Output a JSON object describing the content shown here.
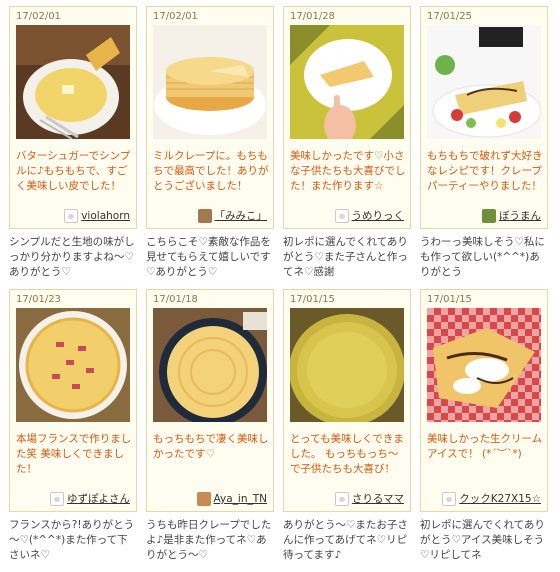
{
  "cards": [
    {
      "date": "17/02/01",
      "message": "バターシュガーでシンプルに♪もちもちで、すごく美味しい皮でした！",
      "author": "violahorn",
      "avatar": "generic-avatar-icon",
      "reply": "シンプルだと生地の味がしっかり分かりますよね～♡ありがとう♡"
    },
    {
      "date": "17/02/01",
      "message": "ミルクレープに。もちもちで最高でした！ありがとうございました！",
      "author": "「みみこ」",
      "avatar": "photo-avatar-icon",
      "reply": "こちらこそ♡素敵な作品を見せてもらえて嬉しいです♡ありがとう♡"
    },
    {
      "date": "17/01/28",
      "message": "美味しかったです♡小さな子供たちも大喜びでした！また作ります☆",
      "author": "うめりっく",
      "avatar": "generic-avatar-icon",
      "reply": "初レポに選んでくれてありがとう♡また子さんと作ってネ♡感謝"
    },
    {
      "date": "17/01/25",
      "message": "もちもちで破れず大好きなレシピです！クレープパーティーやりました！",
      "author": "ぼうまん",
      "avatar": "photo-avatar-icon",
      "reply": "うわーっ美味しそう♡私にも作って欲しい(*^^*)ありがとう"
    },
    {
      "date": "17/01/23",
      "message": "本場フランスで作りました笑 美味しくできました！",
      "author": "ゆずぽよさん",
      "avatar": "generic-avatar-icon",
      "reply": "フランスから?!ありがとう～♡(*^^*)また作って下さいネ♡"
    },
    {
      "date": "17/01/18",
      "message": "もっちもちで凄く美味しかったです♡",
      "author": "Aya_in_TN",
      "avatar": "photo-avatar-icon",
      "reply": "うちも昨日クレープでしたよ♪是非また作ってネ♡ありがとう～♡"
    },
    {
      "date": "17/01/15",
      "message": "とっても美味しくできました。 もっちもっち～で子供たちも大喜び！",
      "author": "さりるママ",
      "avatar": "generic-avatar-icon",
      "reply": "ありがとう～♡またお子さんに作ってあげてネ♡リピ待ってます♪"
    },
    {
      "date": "17/01/15",
      "message": "美味しかった生クリームアイスで！ (*´︶`*)",
      "author": "クックK27X15☆",
      "avatar": "generic-avatar-icon",
      "reply": "初レポに選んでくれてありがとう♡アイス美味しそう♡リピしてネ"
    }
  ]
}
